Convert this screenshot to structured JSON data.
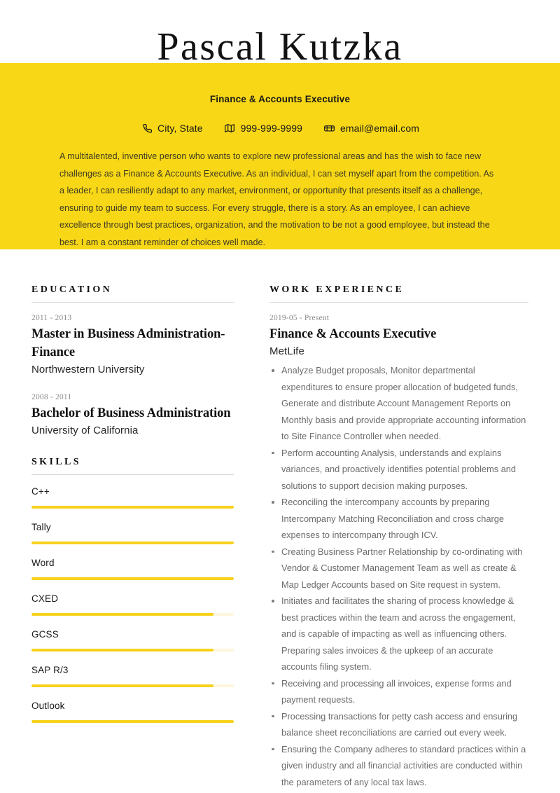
{
  "theme": {
    "accent": "#f7d716",
    "accent_bar": "#f7d21c",
    "bar_track": "#fdf6dc",
    "text_dark": "#111111",
    "text_body": "#6c6c6c",
    "summary_text": "#3f3a24",
    "rule": "#d8d8d8"
  },
  "header": {
    "name": "Pascal Kutzka",
    "job_title": "Finance & Accounts Executive",
    "contacts": [
      {
        "icon": "phone-icon",
        "value": "City, State"
      },
      {
        "icon": "map-icon",
        "value": "999-999-9999"
      },
      {
        "icon": "mailbox-icon",
        "value": "email@email.com"
      }
    ],
    "summary": "A multitalented, inventive person who wants to explore new professional areas and has the wish to face new challenges as a Finance & Accounts Executive. As an individual, I can set myself apart from the competition. As a leader, I can resiliently adapt to any market, environment, or opportunity that presents itself as a challenge, ensuring to guide my team to success. For every struggle, there is a story. As an employee, I can achieve excellence through best practices, organization, and the motivation to be not a good employee, but instead the best. I am a constant reminder of choices well made."
  },
  "education": {
    "heading": "EDUCATION",
    "entries": [
      {
        "date": "2011 - 2013",
        "degree": "Master in Business Administration-Finance",
        "school": "Northwestern University"
      },
      {
        "date": "2008 - 2011",
        "degree": "Bachelor of Business Administration",
        "school": "University of California"
      }
    ]
  },
  "skills": {
    "heading": "SKILLS",
    "items": [
      {
        "label": "C++",
        "level": 100
      },
      {
        "label": "Tally",
        "level": 100
      },
      {
        "label": "Word",
        "level": 100
      },
      {
        "label": "CXED",
        "level": 90
      },
      {
        "label": "GCSS",
        "level": 90
      },
      {
        "label": "SAP R/3",
        "level": 90
      },
      {
        "label": "Outlook",
        "level": 100
      }
    ]
  },
  "work_experience": {
    "heading": "WORK EXPERIENCE",
    "entries": [
      {
        "date": "2019-05 - Present",
        "title": "Finance & Accounts Executive",
        "company": "MetLife",
        "bullets": [
          "Analyze Budget proposals, Monitor departmental expenditures to ensure proper allocation of budgeted funds, Generate and distribute Account Management Reports on Monthly basis and provide appropriate accounting information to Site Finance Controller when needed.",
          "Perform accounting Analysis, understands and explains variances, and proactively identifies potential problems and solutions to support decision making purposes.",
          "Reconciling the intercompany accounts by preparing Intercompany Matching Reconciliation and cross charge expenses to intercompany through ICV.",
          "Creating Business Partner Relationship by co-ordinating  with Vendor & Customer Management Team as well as create & Map Ledger Accounts based on Site request in system.",
          "Initiates and facilitates the sharing of process knowledge & best practices within the team and across the engagement, and is capable of impacting as well as influencing others. Preparing sales invoices & the upkeep of an accurate accounts filing system.",
          "Receiving and processing all invoices, expense forms and payment requests.",
          "Processing transactions for petty cash access and ensuring balance sheet reconciliations are carried out every week.",
          "Ensuring the Company adheres to standard practices within a given industry and all financial activities are conducted within the parameters of any local tax laws."
        ]
      }
    ]
  }
}
